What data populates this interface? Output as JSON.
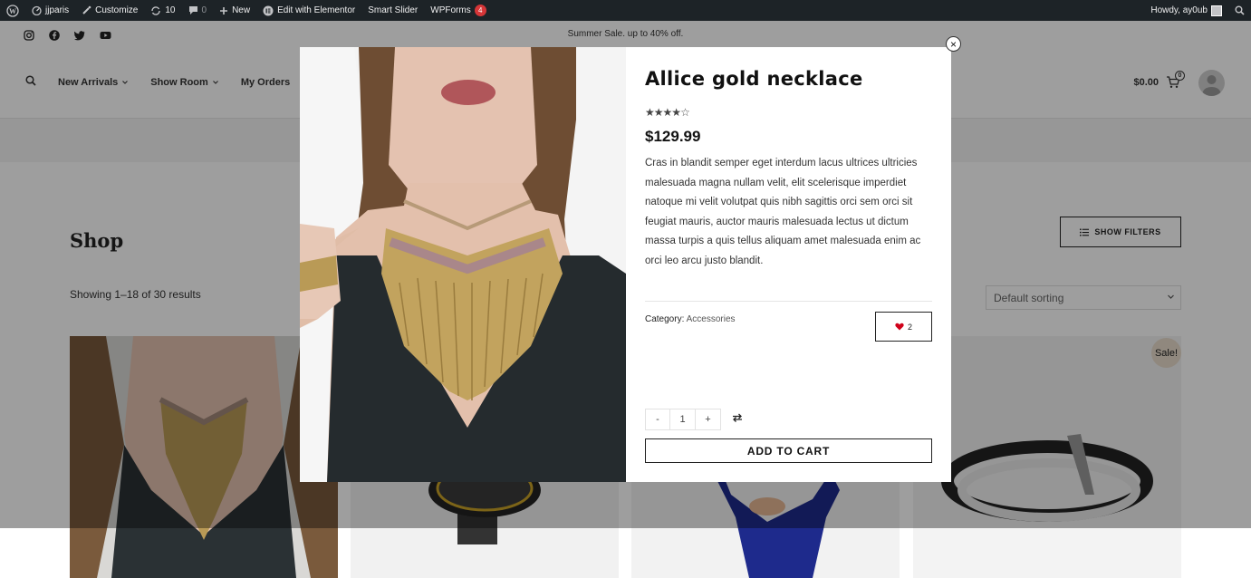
{
  "admin_bar": {
    "site_name": "jjparis",
    "customize": "Customize",
    "updates_count": "10",
    "comments_count": "0",
    "new_label": "New",
    "elementor_label": "Edit with Elementor",
    "smart_slider_label": "Smart Slider",
    "wpforms_label": "WPForms",
    "wpforms_badge": "4",
    "howdy": "Howdy, ay0ub"
  },
  "topbar": {
    "promo": "Summer Sale. up to 40% off.",
    "social_icons": [
      "instagram-icon",
      "facebook-icon",
      "twitter-icon",
      "youtube-icon"
    ]
  },
  "nav": {
    "items": [
      {
        "label": "New Arrivals",
        "has_dropdown": true
      },
      {
        "label": "Show Room",
        "has_dropdown": true
      },
      {
        "label": "My Orders",
        "has_dropdown": false
      }
    ]
  },
  "cart": {
    "total": "$0.00",
    "count": "0"
  },
  "shop": {
    "title": "Shop",
    "results": "Showing 1–18 of 30 results",
    "filters_label": "SHOW FILTERS",
    "sorting_selected": "Default sorting",
    "sale_badge": "Sale!"
  },
  "modal": {
    "title": "Allice gold necklace",
    "rating": 4,
    "rating_max": 5,
    "price": "$129.99",
    "description": "Cras in blandit semper eget interdum lacus ultrices ultricies malesuada magna nullam velit, elit scelerisque imperdiet natoque mi velit volutpat quis nibh sagittis orci sem orci sit feugiat mauris, auctor mauris malesuada lectus ut dictum massa turpis a quis tellus aliquam amet malesuada enim ac orci leo arcu justo blandit.",
    "category_label": "Category:",
    "category_value": "Accessories",
    "wishlist_count": "2",
    "qty_minus": "-",
    "qty_value": "1",
    "qty_plus": "+",
    "add_to_cart": "ADD TO CART",
    "close": "×"
  },
  "colors": {
    "admin_bar_bg": "#1d2327",
    "wishlist_heart": "#d0021b",
    "badge_red": "#d63638",
    "dress_blue": "#1e2a8c"
  }
}
